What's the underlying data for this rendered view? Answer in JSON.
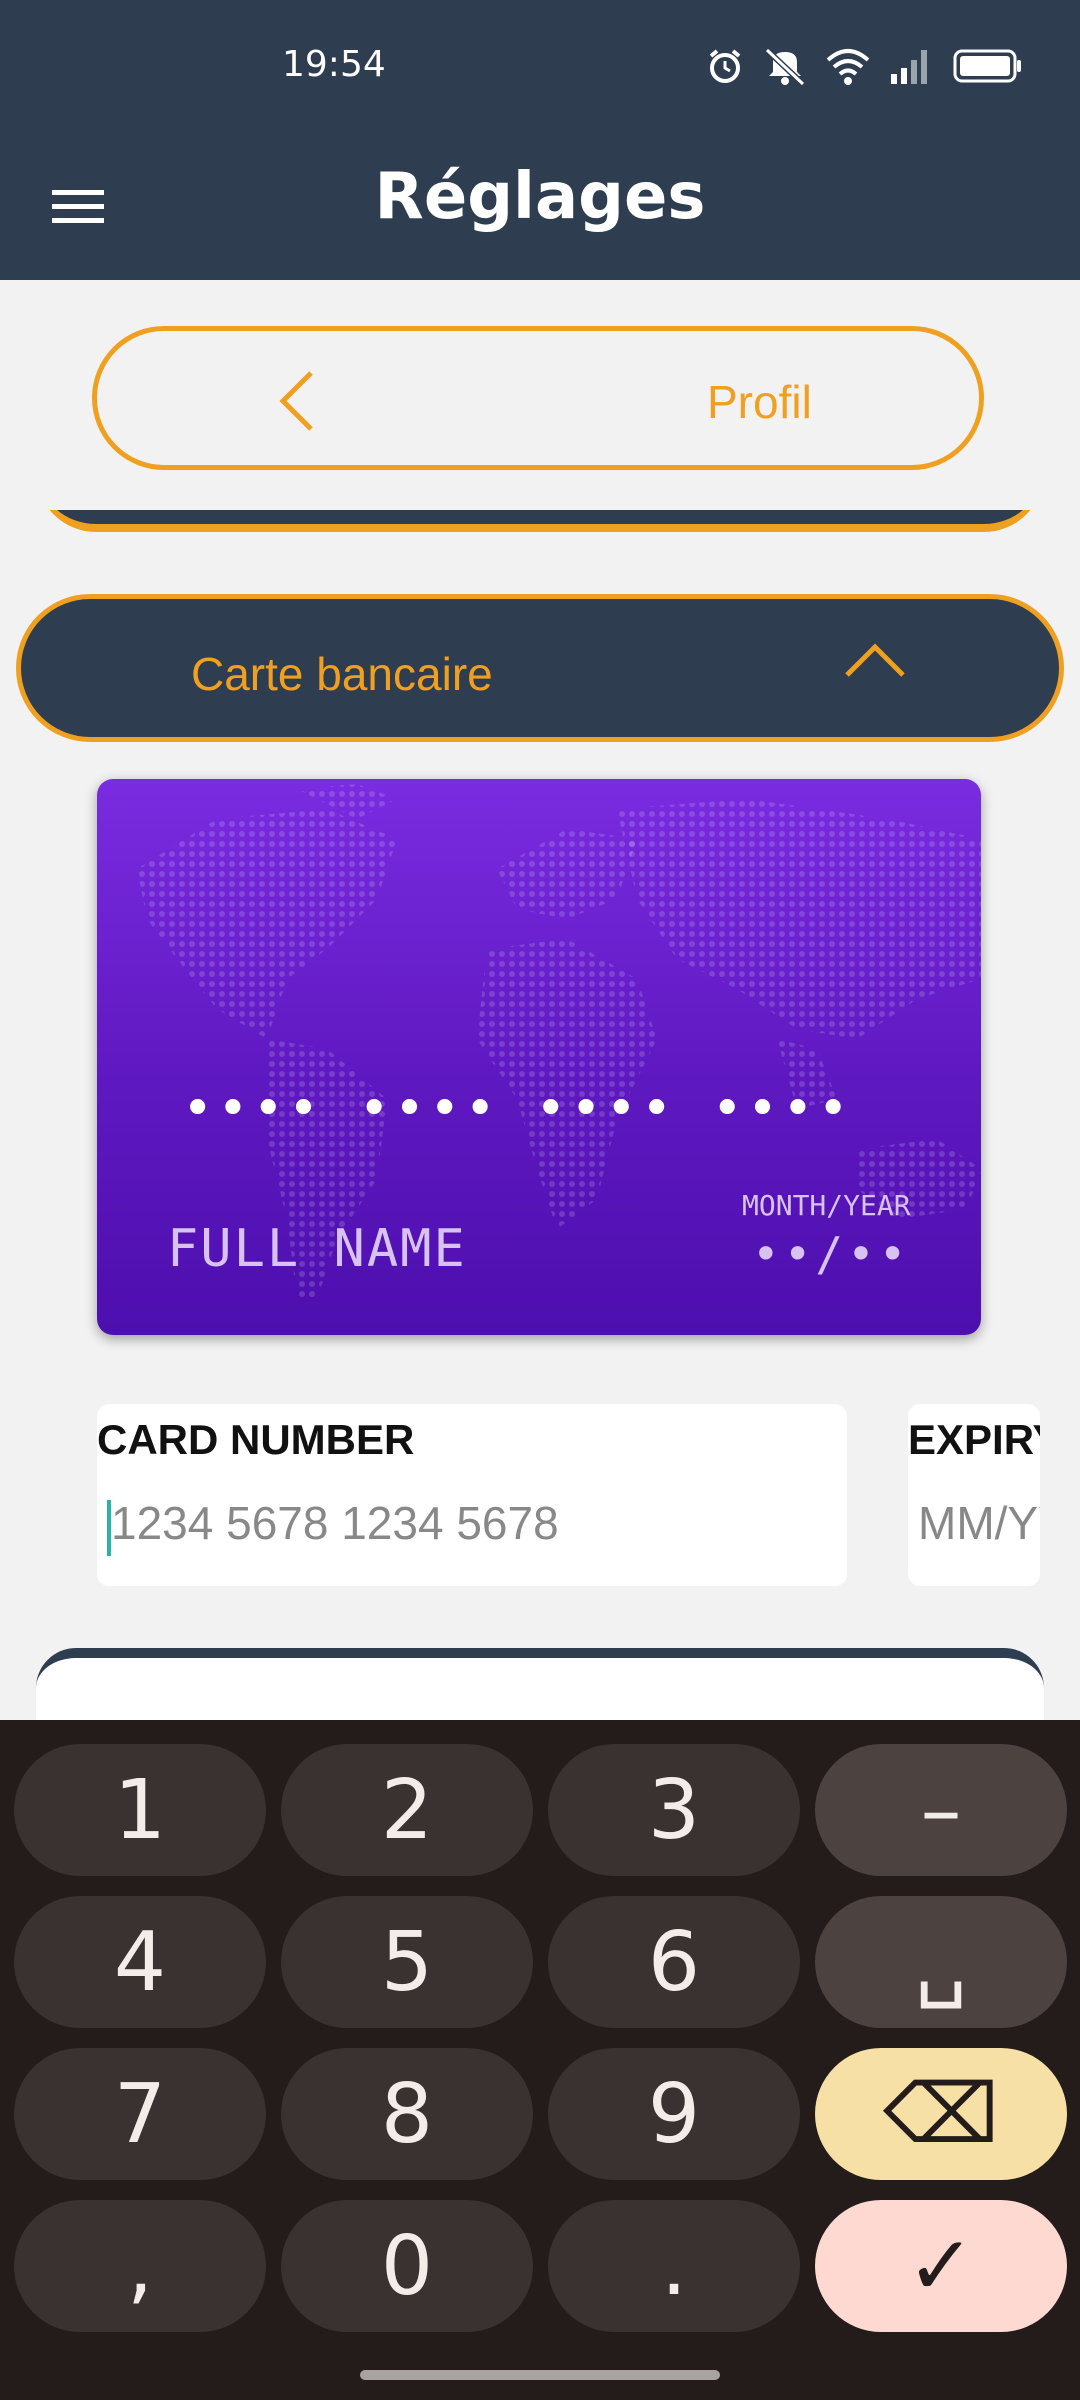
{
  "status_bar": {
    "time": "19:54",
    "icons": [
      "alarm-icon",
      "mute-icon",
      "wifi-icon",
      "signal-icon",
      "battery-icon"
    ]
  },
  "app_bar": {
    "title": "Réglages",
    "menu_icon": "hamburger-menu-icon"
  },
  "back_nav": {
    "label": "Profil",
    "icon": "chevron-left-icon"
  },
  "section": {
    "label": "Carte bancaire",
    "icon": "chevron-up-icon",
    "expanded": true
  },
  "card_preview": {
    "number_mask": "•••• •••• •••• ••••",
    "name_placeholder": "FULL NAME",
    "expiry_label": "MONTH/YEAR",
    "expiry_mask": "••/••"
  },
  "form": {
    "card_number": {
      "label": "CARD NUMBER",
      "placeholder": "1234 5678 1234 5678",
      "value": ""
    },
    "expiry": {
      "label": "EXPIRY",
      "placeholder": "MM/YY",
      "value": ""
    }
  },
  "keyboard": {
    "keys": [
      [
        "1",
        "2",
        "3",
        "–"
      ],
      [
        "4",
        "5",
        "6",
        "␣"
      ],
      [
        "7",
        "8",
        "9",
        "⌫"
      ],
      [
        ",",
        "0",
        ".",
        "✓"
      ]
    ]
  },
  "colors": {
    "header": "#2e3d4f",
    "accent": "#f0a020",
    "card": "#6a22d6",
    "keyboard_bg": "#231c1b",
    "key": "#3a3230"
  }
}
